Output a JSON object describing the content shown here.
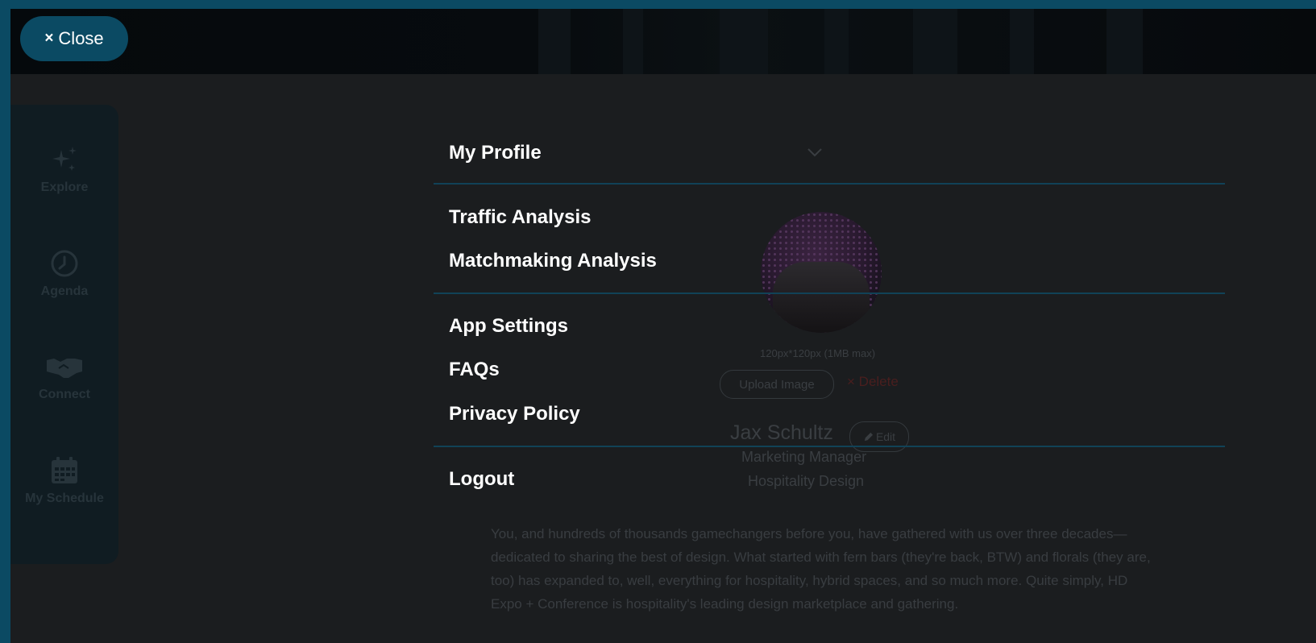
{
  "top_bar": {
    "close_icon": "×",
    "close_label": "Close"
  },
  "sidebar": {
    "items": [
      {
        "label": "Explore",
        "icon": "sparkles-icon"
      },
      {
        "label": "Agenda",
        "icon": "clock-icon"
      },
      {
        "label": "Connect",
        "icon": "handshake-icon"
      },
      {
        "label": "My Schedule",
        "icon": "calendar-icon"
      }
    ]
  },
  "menu": {
    "my_profile": "My Profile",
    "traffic_analysis": "Traffic Analysis",
    "matchmaking_analysis": "Matchmaking Analysis",
    "app_settings": "App Settings",
    "faqs": "FAQs",
    "privacy_policy": "Privacy Policy",
    "logout": "Logout"
  },
  "profile": {
    "image_hint": "120px*120px (1MB max)",
    "upload_label": "Upload Image",
    "delete_icon": "×",
    "delete_label": "Delete",
    "name": "Jax Schultz",
    "edit_label": "Edit",
    "job_title": "Marketing Manager",
    "company": "Hospitality Design",
    "bio": "You, and hundreds of thousands gamechangers before you, have gathered with us over three decades—dedicated to sharing the best of design. What started with fern bars (they're back, BTW) and florals (they are, too) has expanded to, well, everything for hospitality, hybrid spaces, and so much more. Quite simply, HD Expo + Conference is hospitality's leading design marketplace and gathering."
  },
  "colors": {
    "frame_border": "#0b4a63",
    "overlay_bg": "#1b1d1f",
    "accent": "#0b4a63",
    "divider": "#114257",
    "menu_text": "#ffffff"
  }
}
